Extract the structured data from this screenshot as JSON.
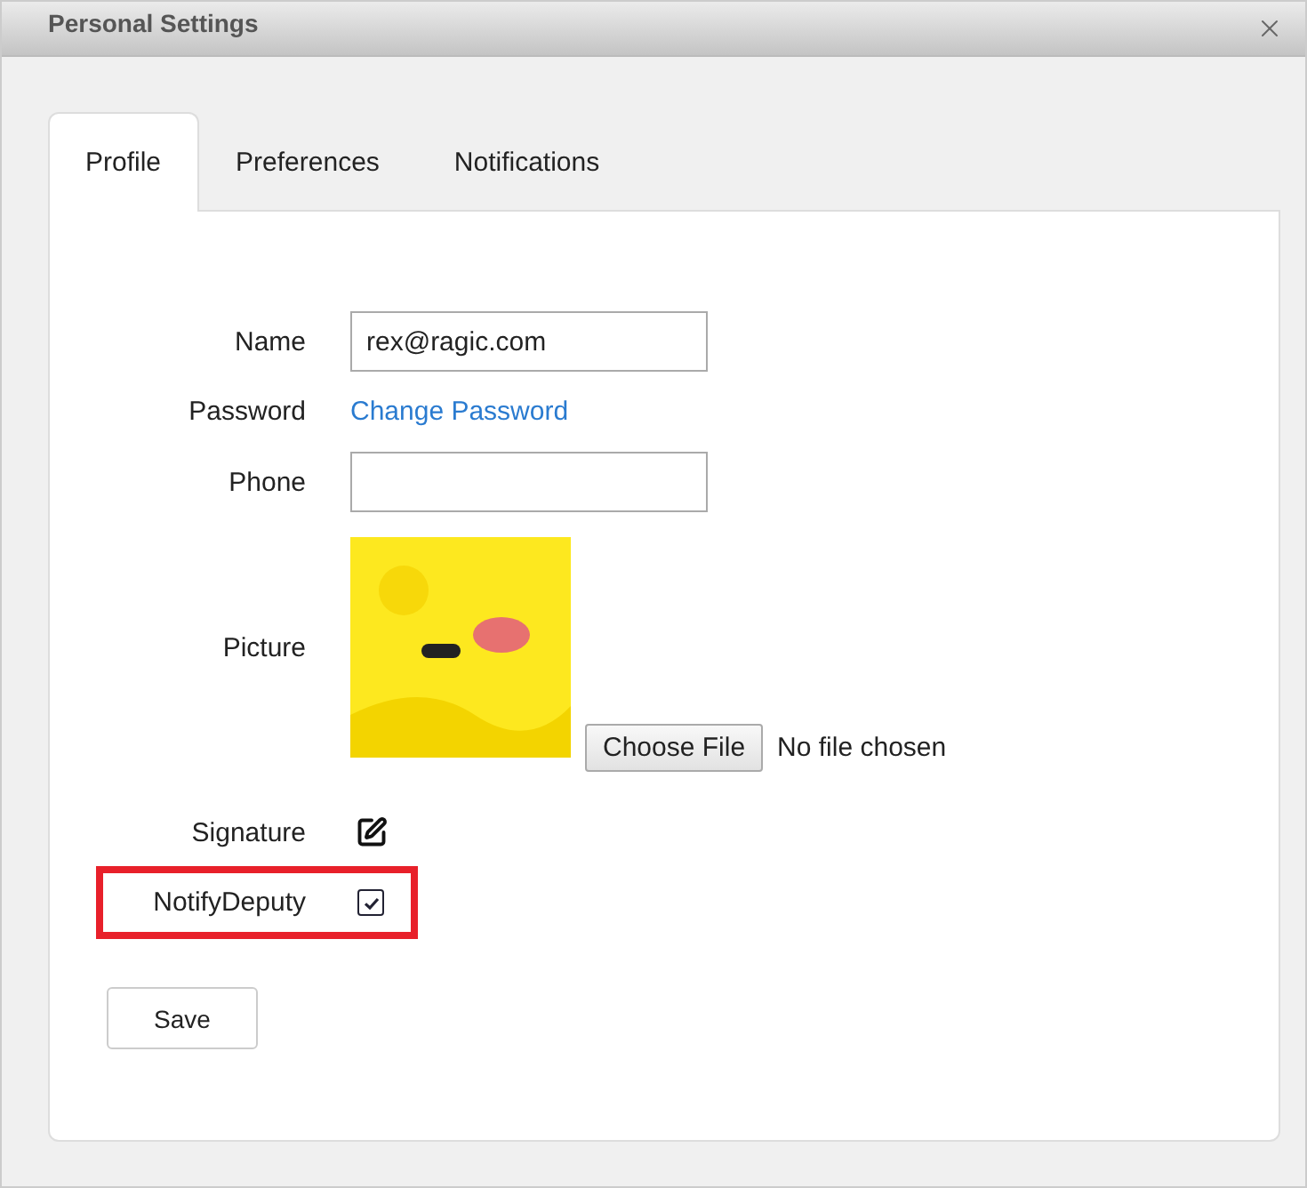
{
  "window": {
    "title": "Personal Settings"
  },
  "tabs": [
    {
      "label": "Profile",
      "selected": true
    },
    {
      "label": "Preferences",
      "selected": false
    },
    {
      "label": "Notifications",
      "selected": false
    }
  ],
  "fields": [
    {
      "kind": "text",
      "label": "Name",
      "value": "rex@ragic.com",
      "highlighted": false
    },
    {
      "kind": "link",
      "label": "Password",
      "link": "Change Password",
      "highlighted": false
    },
    {
      "kind": "text",
      "label": "Phone",
      "highlighted": false
    },
    {
      "kind": "file",
      "label": "Picture",
      "button": "Choose File",
      "status": "No file chosen",
      "highlighted": false
    },
    {
      "kind": "edit",
      "label": "Signature",
      "highlighted": false
    },
    {
      "kind": "checkbox",
      "label": "NotifyDeputy",
      "checked": true,
      "highlighted": true
    }
  ],
  "save_button": "Save"
}
